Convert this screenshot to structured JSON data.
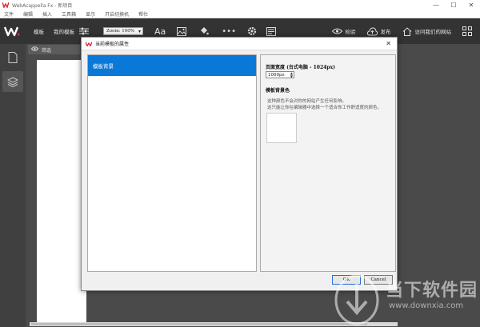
{
  "titlebar": {
    "title": "WebAcappella Fx - 新项目",
    "minimize": "—",
    "maximize": "☐",
    "close": "✕"
  },
  "menu": [
    "文件",
    "编辑",
    "插入",
    "工具箱",
    "显示",
    "开启切换机",
    "帮忙"
  ],
  "toolbar": {
    "template": "模板",
    "my_template": "我的模板",
    "zoom": "Zoom: 100%",
    "text_style": "Aa",
    "check": "检验",
    "publish": "发布",
    "visit": "访问我们的网站"
  },
  "panel": {
    "tab_label": "筛选"
  },
  "dialog": {
    "title": "当前模板的属性",
    "list_items": [
      "模板背景"
    ],
    "page_width_heading": "页面宽度 (台式电脑 - 1024px)",
    "page_width_value": "1000px",
    "bg_color_heading": "模板背景色",
    "desc_line1": "这种颜色不会对你的网站产生任何影响。",
    "desc_line2": "这只能让你在编辑器中选择一个适合你工作舒适度的颜色。",
    "ok": "OK",
    "cancel": "Cancel"
  },
  "watermark": {
    "line1": "当下软件园",
    "line2": "www.downxia.com"
  },
  "colors": {
    "toolbar_bg": "#333333",
    "selection_blue": "#0a78d7",
    "brand_red": "#d9272e"
  }
}
